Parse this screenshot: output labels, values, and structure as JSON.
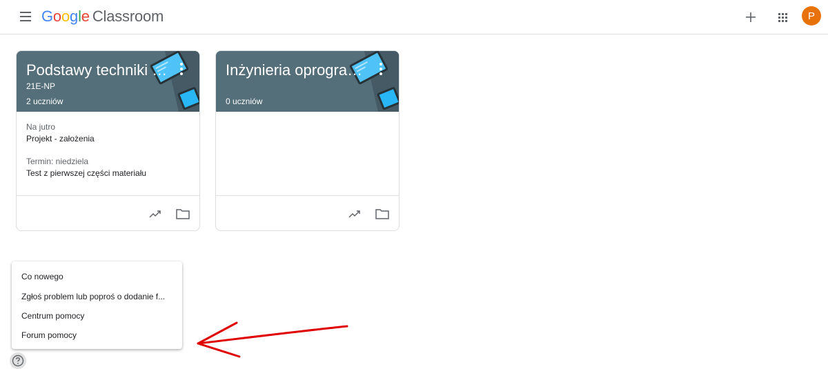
{
  "header": {
    "logo_google": [
      "G",
      "o",
      "o",
      "g",
      "l",
      "e"
    ],
    "logo_google_colors": [
      "#4285F4",
      "#EA4335",
      "#FBBC05",
      "#4285F4",
      "#34A853",
      "#EA4335"
    ],
    "logo_product": "Classroom",
    "menu_icon": "hamburger-menu-icon",
    "add_icon": "plus-icon",
    "apps_icon": "apps-grid-icon",
    "avatar_initial": "P",
    "avatar_color": "#E8710A"
  },
  "classes": [
    {
      "title": "Podstawy techniki mi...",
      "section": "21E-NP",
      "students": "2 uczniów",
      "header_color": "#546E7A",
      "due": [
        {
          "label": "Na jutro",
          "item": "Projekt - założenia"
        },
        {
          "label": "Termin: niedziela",
          "item": "Test z pierwszej części materiału"
        }
      ],
      "actions": [
        "trending-up-icon",
        "folder-icon"
      ]
    },
    {
      "title": "Inżynieria oprogramo...",
      "section": "",
      "students": "0 uczniów",
      "header_color": "#546E7A",
      "due": [],
      "actions": [
        "trending-up-icon",
        "folder-icon"
      ]
    }
  ],
  "help_menu": {
    "items": [
      "Co nowego",
      "Zgłoś problem lub poproś o dodanie f...",
      "Centrum pomocy",
      "Forum pomocy"
    ],
    "button_icon": "help-circle-icon"
  },
  "annotation": {
    "arrow_color": "#E00000"
  }
}
